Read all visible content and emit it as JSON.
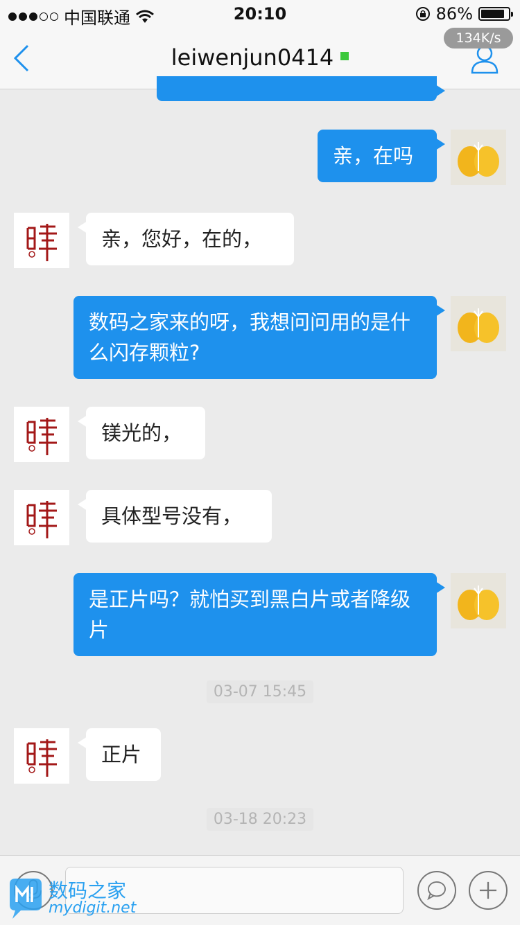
{
  "status_bar": {
    "carrier": "中国联通",
    "time": "20:10",
    "battery": "86%",
    "battery_level": 0.86
  },
  "nav": {
    "title": "leiwenjun0414",
    "speed": "134K/s",
    "back_icon": "chevron-left-icon",
    "profile_icon": "person-icon"
  },
  "messages": [
    {
      "side": "me",
      "text": "亲，在吗"
    },
    {
      "side": "them",
      "text": "亲，您好，在的，"
    },
    {
      "side": "me",
      "text": "数码之家来的呀，我想问问用的是什么闪存颗粒?"
    },
    {
      "side": "them",
      "text": "镁光的，"
    },
    {
      "side": "them",
      "text": "具体型号没有，"
    },
    {
      "side": "me",
      "text": "是正片吗？就怕买到黑白片或者降级片"
    },
    {
      "side": "them",
      "text": "正片"
    }
  ],
  "timestamps": [
    "03-07 15:45",
    "03-18 20:23"
  ],
  "input_bar": {
    "placeholder": "",
    "voice_icon": "microphone-icon",
    "emoji_icon": "chat-bubble-icon",
    "plus_icon": "plus-icon"
  },
  "watermark": {
    "text": "数码之家",
    "url": "mydigit.net"
  },
  "colors": {
    "accent": "#1e91ed",
    "background": "#ebebeb",
    "online": "#3cc83c"
  }
}
